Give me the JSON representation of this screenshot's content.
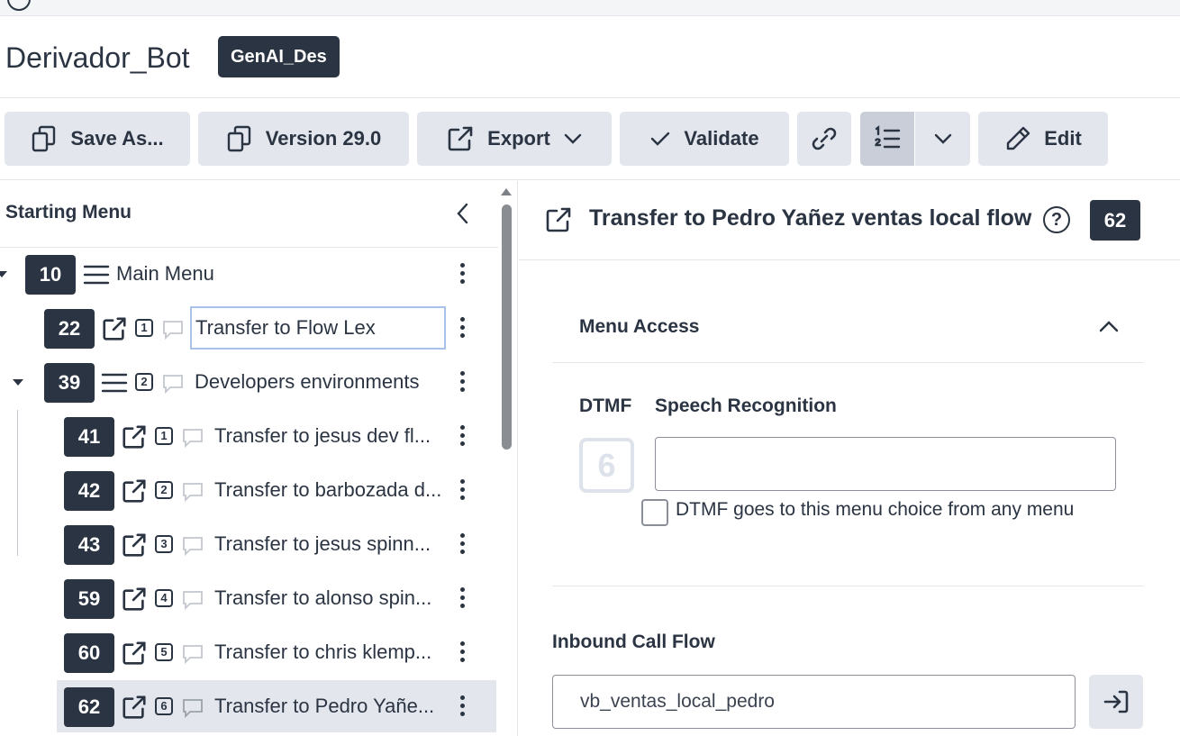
{
  "header": {
    "app_title": "Derivador_Bot",
    "env_badge": "GenAI_Des"
  },
  "toolbar": {
    "save_as": "Save As...",
    "version": "Version 29.0",
    "export": "Export",
    "validate": "Validate",
    "edit": "Edit"
  },
  "tree": {
    "title": "Starting Menu",
    "rows": [
      {
        "id": "10",
        "dtmf": "",
        "label": "Main Menu",
        "type": "menu"
      },
      {
        "id": "22",
        "dtmf": "1",
        "label": "Transfer to Flow Lex",
        "type": "transfer"
      },
      {
        "id": "39",
        "dtmf": "2",
        "label": "Developers environments",
        "type": "menu"
      },
      {
        "id": "41",
        "dtmf": "1",
        "label": "Transfer to jesus dev fl...",
        "type": "transfer"
      },
      {
        "id": "42",
        "dtmf": "2",
        "label": "Transfer to barbozada d...",
        "type": "transfer"
      },
      {
        "id": "43",
        "dtmf": "3",
        "label": "Transfer to jesus spinn...",
        "type": "transfer"
      },
      {
        "id": "59",
        "dtmf": "4",
        "label": "Transfer to alonso spin...",
        "type": "transfer"
      },
      {
        "id": "60",
        "dtmf": "5",
        "label": "Transfer to chris klemp...",
        "type": "transfer"
      },
      {
        "id": "62",
        "dtmf": "6",
        "label": "Transfer to Pedro Yañe...",
        "type": "transfer"
      }
    ]
  },
  "detail": {
    "title": "Transfer to Pedro Yañez ventas local flow",
    "help": "?",
    "number": "62",
    "menu_access": {
      "title": "Menu Access",
      "dtmf_label": "DTMF",
      "speech_label": "Speech Recognition",
      "dtmf_value": "6",
      "speech_value": "",
      "any_menu_label": "DTMF goes to this menu choice from any menu"
    },
    "inbound": {
      "label": "Inbound Call Flow",
      "value": "vb_ventas_local_pedro"
    }
  },
  "colors": {
    "dark": "#2b3442",
    "button_bg": "#e3e6ed",
    "selected_row": "#e3e6ed",
    "border": "#e2e5ea"
  }
}
